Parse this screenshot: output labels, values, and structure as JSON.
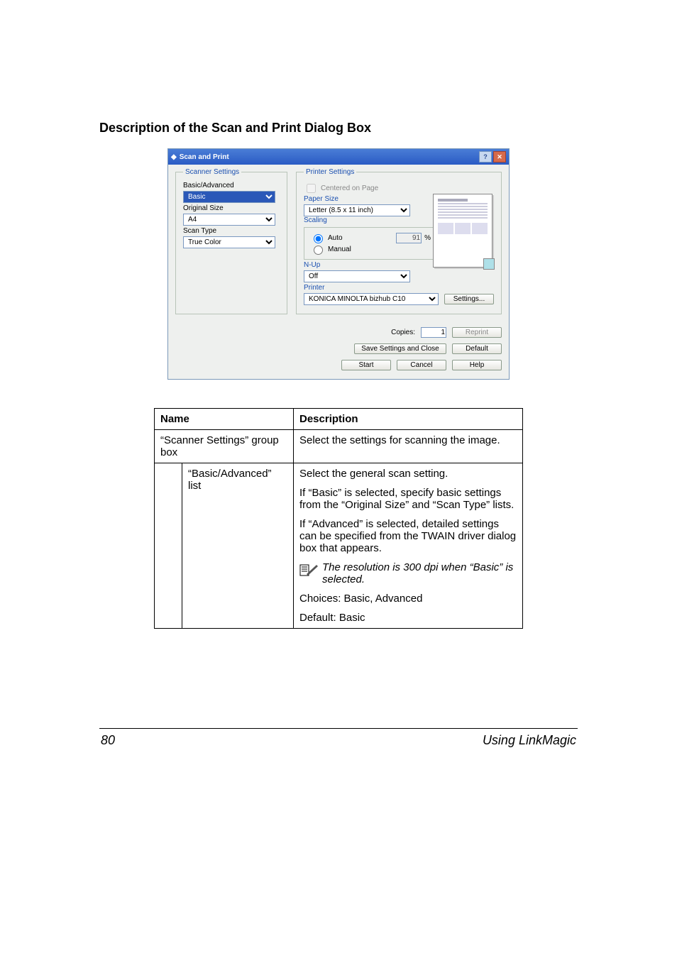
{
  "heading": "Description of the Scan and Print Dialog Box",
  "dialog": {
    "title": "Scan and Print",
    "scanner": {
      "group_label": "Scanner Settings",
      "basic_adv_label": "Basic/Advanced",
      "basic_adv_value": "Basic",
      "original_size_label": "Original Size",
      "original_size_value": "A4",
      "scan_type_label": "Scan Type",
      "scan_type_value": "True Color"
    },
    "printer": {
      "group_label": "Printer Settings",
      "centered_label": "Centered on Page",
      "paper_size_label": "Paper Size",
      "paper_size_value": "Letter (8.5 x 11 inch)",
      "scaling_label": "Scaling",
      "auto_label": "Auto",
      "manual_label": "Manual",
      "manual_value": "91",
      "manual_suffix": "%",
      "nup_label": "N-Up",
      "nup_value": "Off",
      "printer_label": "Printer",
      "printer_value": "KONICA MINOLTA bizhub C10",
      "settings_btn": "Settings...",
      "copies_label": "Copies:",
      "copies_value": "1",
      "reprint_btn": "Reprint"
    },
    "buttons": {
      "save_close": "Save Settings and Close",
      "default": "Default",
      "start": "Start",
      "cancel": "Cancel",
      "help": "Help"
    }
  },
  "table": {
    "header_name": "Name",
    "header_desc": "Description",
    "row1_name": "“Scanner Settings” group box",
    "row1_desc": "Select the settings for scanning the image.",
    "row2_name": "“Basic/Advanced” list",
    "row2_desc": {
      "p1": "Select the general scan setting.",
      "p2": "If “Basic” is selected, specify basic settings from the “Original Size” and “Scan Type” lists.",
      "p3": "If “Advanced” is selected, detailed settings can be specified from the TWAIN driver dialog box that appears.",
      "note": "The resolution is 300 dpi when “Basic” is selected.",
      "p4": "Choices: Basic, Advanced",
      "p5": "Default: Basic"
    }
  },
  "footer": {
    "page_no": "80",
    "section": "Using LinkMagic"
  }
}
